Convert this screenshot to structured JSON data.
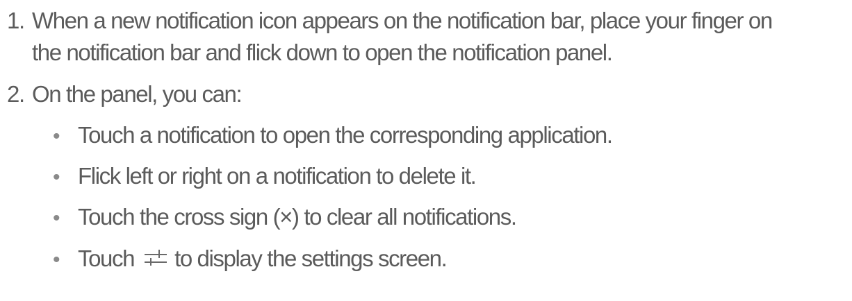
{
  "steps": [
    {
      "number": "1.",
      "text_line1": "When a new notification icon appears on the notification bar, place your finger on",
      "text_line2": "the notification bar and flick down to open the notification panel."
    },
    {
      "number": "2.",
      "text": "On the panel, you can:"
    }
  ],
  "bullet_symbol": "•",
  "bullets": [
    {
      "text": "Touch a notification to open the corresponding application."
    },
    {
      "text": "Flick left or right on a notification to delete it."
    },
    {
      "text": "Touch the cross sign (×) to clear all notifications."
    },
    {
      "text_before": "Touch",
      "icon": "settings-sliders-icon",
      "text_after": "to display the settings screen."
    }
  ]
}
